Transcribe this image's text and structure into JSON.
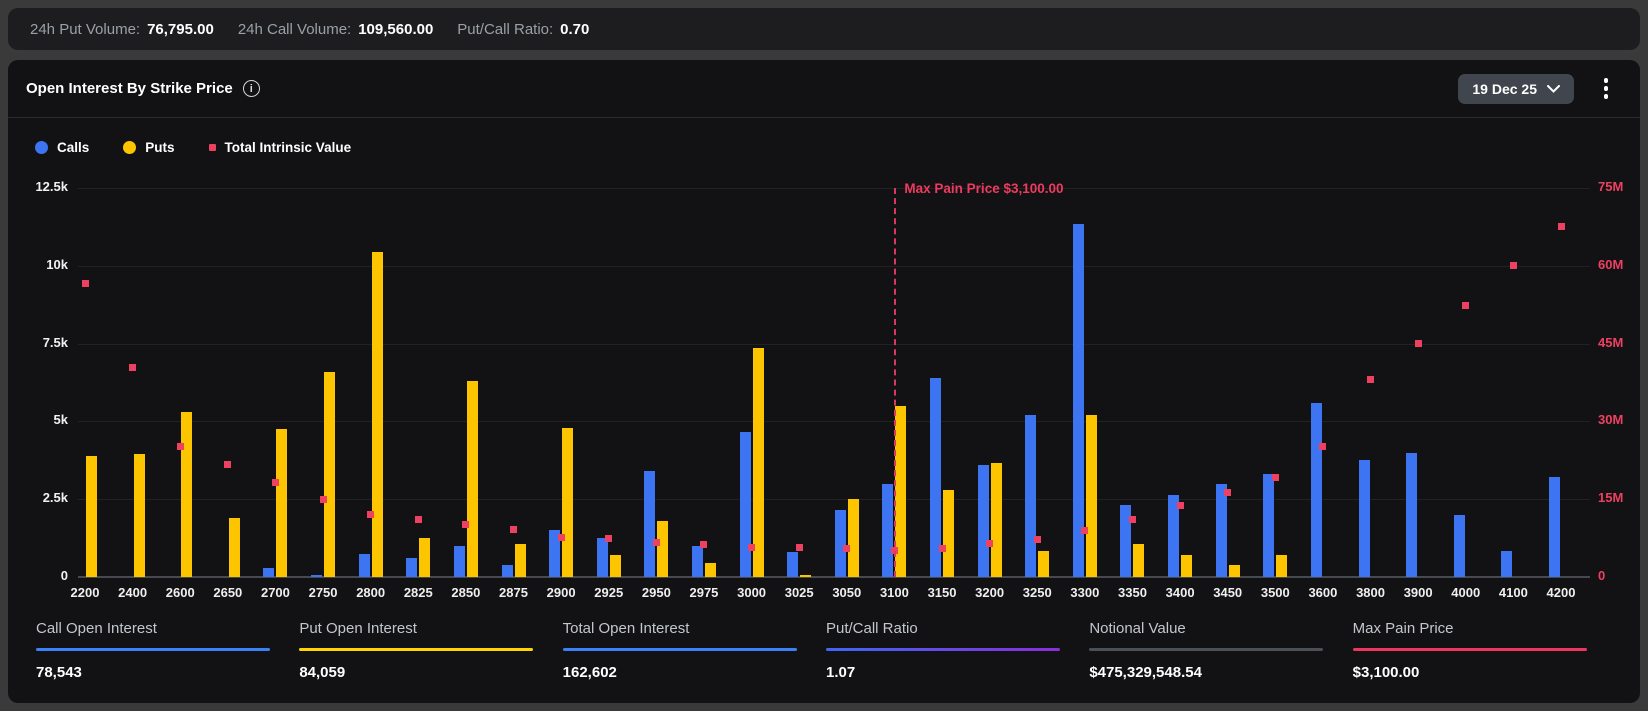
{
  "top_bar": {
    "stats": [
      {
        "label": "24h Put Volume:",
        "value": "76,795.00"
      },
      {
        "label": "24h Call Volume:",
        "value": "109,560.00"
      },
      {
        "label": "Put/Call Ratio:",
        "value": "0.70"
      }
    ]
  },
  "panel": {
    "title": "Open Interest By Strike Price",
    "info_icon": "i",
    "expiry_selector": {
      "label": "19 Dec 25"
    },
    "legend": [
      {
        "label": "Calls",
        "color": "#3c74f1",
        "shape": "circle"
      },
      {
        "label": "Puts",
        "color": "#fdc500",
        "shape": "circle"
      },
      {
        "label": "Total Intrinsic Value",
        "color": "#ee4061",
        "shape": "square"
      }
    ],
    "summary": {
      "items": [
        {
          "label": "Call Open Interest",
          "value": "78,543",
          "underline": "#3b82f6"
        },
        {
          "label": "Put Open Interest",
          "value": "84,059",
          "underline": "#ffd400"
        },
        {
          "label": "Total Open Interest",
          "value": "162,602",
          "underline": "#3b82f6"
        },
        {
          "label": "Put/Call Ratio",
          "value": "1.07",
          "underline": "linear-gradient(90deg,#3f66f5,#8a2fd8)"
        },
        {
          "label": "Notional Value",
          "value": "$475,329,548.54",
          "underline": "#4b5056"
        },
        {
          "label": "Max Pain Price",
          "value": "$3,100.00",
          "underline": "#f0355e"
        }
      ]
    }
  },
  "chart_data": {
    "type": "bar",
    "categories": [
      "2200",
      "2400",
      "2600",
      "2650",
      "2700",
      "2750",
      "2800",
      "2825",
      "2850",
      "2875",
      "2900",
      "2925",
      "2950",
      "2975",
      "3000",
      "3025",
      "3050",
      "3100",
      "3150",
      "3200",
      "3250",
      "3300",
      "3350",
      "3400",
      "3450",
      "3500",
      "3600",
      "3800",
      "3900",
      "4000",
      "4100",
      "4200"
    ],
    "series": [
      {
        "name": "Calls",
        "type": "bar",
        "axis": "left",
        "color": "#3c74f1",
        "values": [
          0,
          0,
          0,
          0,
          300,
          80,
          750,
          600,
          1000,
          400,
          1500,
          1250,
          3400,
          1000,
          4650,
          800,
          2150,
          3000,
          6400,
          3600,
          5200,
          11350,
          2300,
          2650,
          3000,
          3300,
          5600,
          3750,
          4000,
          2000,
          850,
          3200
        ]
      },
      {
        "name": "Puts",
        "type": "bar",
        "axis": "left",
        "color": "#fdc500",
        "values": [
          3900,
          3950,
          5300,
          1900,
          4750,
          6600,
          10450,
          1250,
          6300,
          1050,
          4800,
          700,
          1800,
          450,
          7350,
          60,
          2500,
          5500,
          2800,
          3650,
          850,
          5200,
          1050,
          700,
          400,
          700,
          0,
          0,
          0,
          0,
          0,
          0
        ]
      },
      {
        "name": "Total Intrinsic Value",
        "type": "scatter",
        "axis": "right",
        "unit": "M",
        "color": "#ee4061",
        "values": [
          56.5,
          40.4,
          25.2,
          21.7,
          18.3,
          15.0,
          12.1,
          11.0,
          10.2,
          9.2,
          7.7,
          7.5,
          6.7,
          6.2,
          5.6,
          5.6,
          5.4,
          5.2,
          5.4,
          6.4,
          7.3,
          9.0,
          11.1,
          13.7,
          16.3,
          19.2,
          25.2,
          38.1,
          45.0,
          52.3,
          60.0,
          67.5
        ]
      }
    ],
    "left_axis": {
      "ticks_top_down": [
        "12.5k",
        "10k",
        "7.5k",
        "5k",
        "2.5k",
        "0"
      ],
      "max": 12500,
      "color": "#f1f1f1"
    },
    "right_axis": {
      "ticks_top_down": [
        "75M",
        "60M",
        "45M",
        "30M",
        "15M",
        "0"
      ],
      "max": 75,
      "unit": "M",
      "color": "#ee4061"
    },
    "annotation": {
      "label": "Max Pain Price $3,100.00",
      "category": "3100",
      "color": "#ee3a60"
    },
    "grid": true,
    "legend_position": "top-left",
    "title": "Open Interest By Strike Price"
  }
}
